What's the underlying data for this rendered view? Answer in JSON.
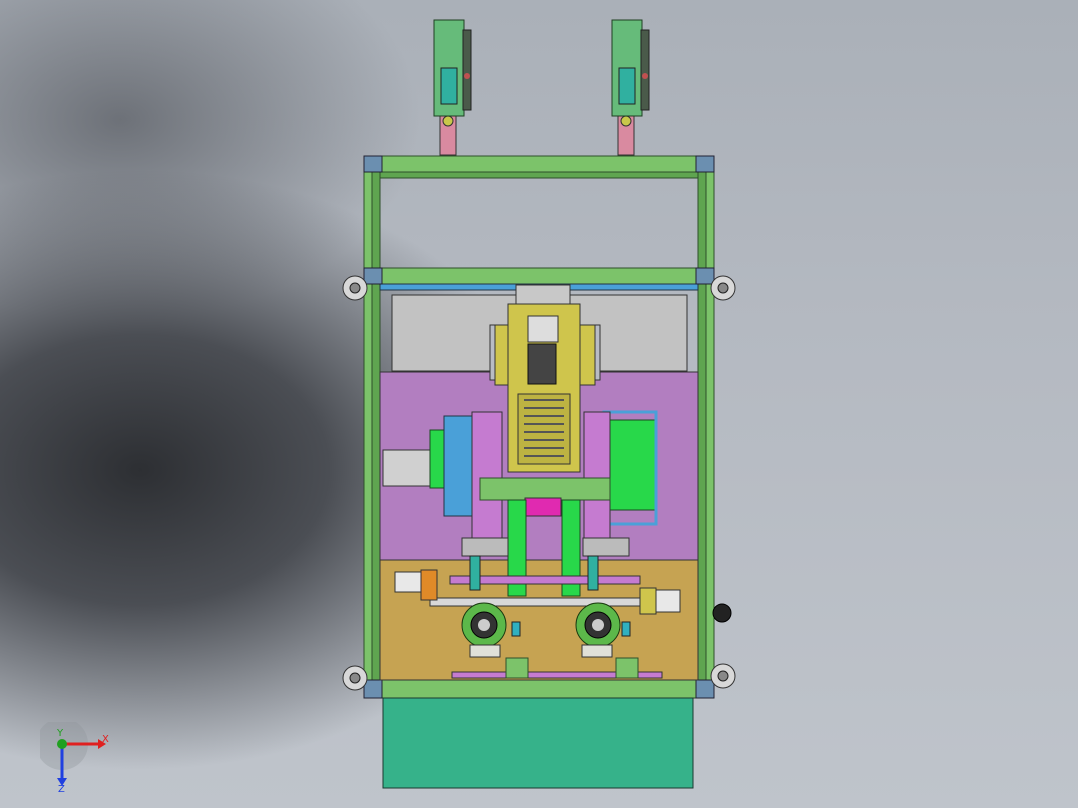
{
  "viewport": {
    "background_top": "#aab0b8",
    "background_bottom": "#bfc4cb",
    "shadow_color": "#2d2f33"
  },
  "colors": {
    "frame_green": "#7cc36a",
    "frame_edge": "#2e4f2a",
    "magenta_panel": "#b27ec0",
    "tan_panel": "#c6a352",
    "gray_window": "#c2c2c2",
    "blue_trim": "#4aa0d8",
    "teal_base": "#36b28a",
    "motor_yellow": "#cfc54c",
    "sensor_green": "#66bb7a",
    "pink_post": "#d98aa0",
    "bright_green": "#28d84a",
    "hot_pink": "#e02ab0"
  },
  "triad": {
    "x_label": "X",
    "y_label": "Y",
    "z_label": "Z",
    "x_color": "#e02020",
    "y_color": "#20a020",
    "z_color": "#2040e0"
  }
}
